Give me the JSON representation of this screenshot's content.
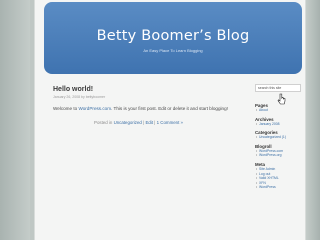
{
  "blog": {
    "title": "Betty Boomer’s Blog",
    "tagline": "An Easy Place To Learn Blogging"
  },
  "post": {
    "title": "Hello world!",
    "meta": "January 26, 2008 by bettyboomer",
    "body_text": "Welcome to ",
    "body_link": "WordPress.com",
    "body_rest": ". This is your first post. Edit or delete it and start blogging!",
    "footer_prefix": "Posted in ",
    "footer_category": "Uncategorized",
    "footer_sep1": " | ",
    "footer_edit": "Edit",
    "footer_sep2": " | ",
    "footer_comments": "1 Comment »"
  },
  "sidebar": {
    "search_placeholder": "search this site",
    "pages": {
      "title": "Pages",
      "items": [
        "About"
      ]
    },
    "archives": {
      "title": "Archives",
      "items": [
        "January 2008"
      ]
    },
    "categories": {
      "title": "Categories",
      "items": [
        "Uncategorized (1)"
      ]
    },
    "blogroll": {
      "title": "Blogroll",
      "items": [
        "WordPress.com",
        "WordPress.org"
      ]
    },
    "meta": {
      "title": "Meta",
      "items": [
        "Site Admin",
        "Log out",
        "Valid XHTML",
        "XFN",
        "WordPress"
      ]
    }
  },
  "colors": {
    "header_bg": "#4a7fbd",
    "link": "#3a6ea5",
    "frame": "#bfc7c4"
  }
}
